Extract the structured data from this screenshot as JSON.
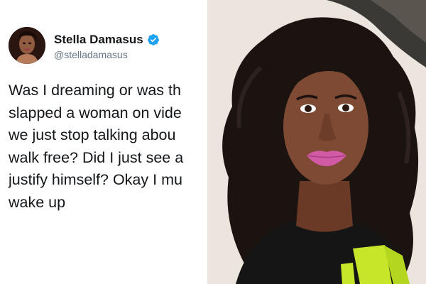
{
  "tweet": {
    "display_name": "Stella Damasus",
    "handle": "@stelladamasus",
    "verified": true,
    "lines": [
      "Was I dreaming or was th",
      "slapped a woman on vide",
      "we just stop talking abou",
      "walk free? Did I just see a",
      "justify himself? Okay I mu",
      "wake up"
    ]
  },
  "colors": {
    "verified_badge": "#1da1f2",
    "name_text": "#14171a",
    "handle_text": "#657786",
    "shirt_print": "#c7e62a",
    "lips": "#d05aa4"
  },
  "icons": {
    "verified": "verified-badge-icon"
  }
}
